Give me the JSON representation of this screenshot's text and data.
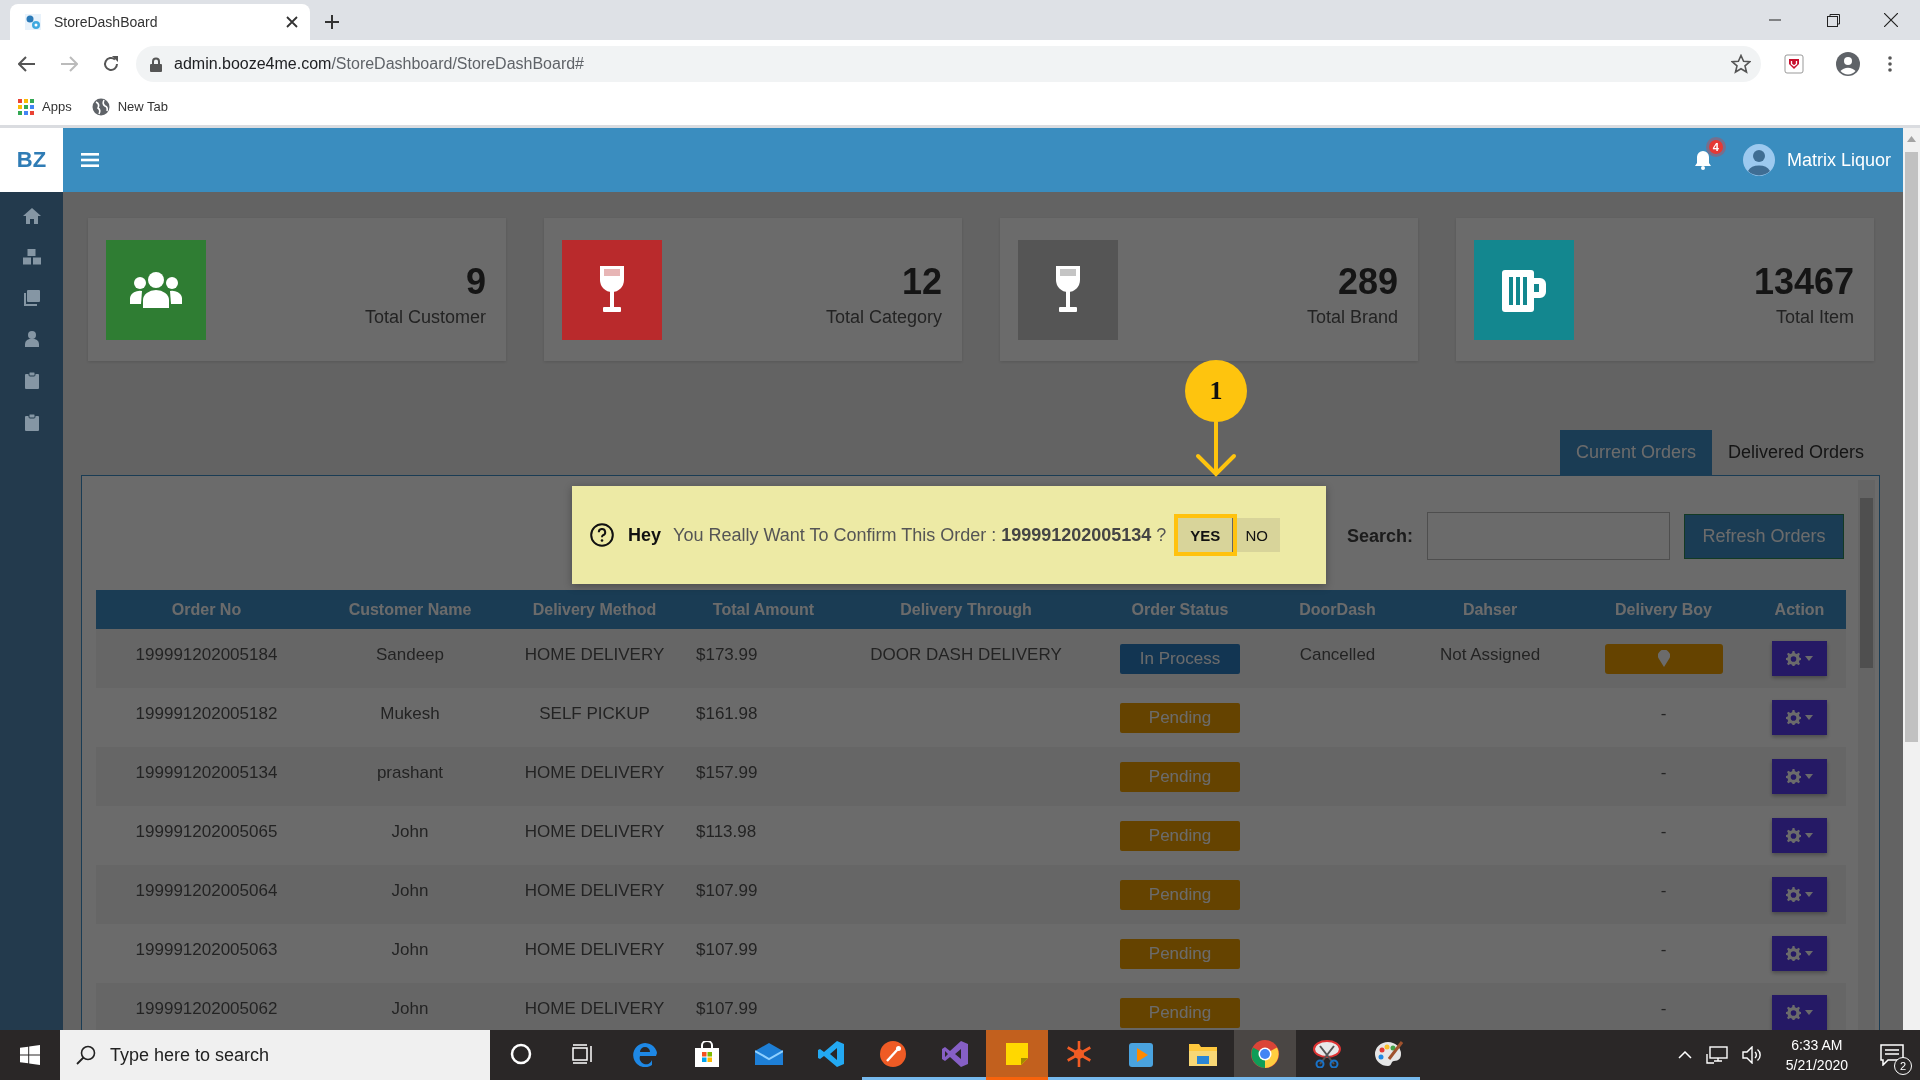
{
  "browser": {
    "tab_title": "StoreDashBoard",
    "url_host": "admin.booze4me.com",
    "url_path": "/StoreDashboard/StoreDashBoard#",
    "forward_disabled": true,
    "bookmarks": [
      {
        "kind": "apps",
        "label": "Apps"
      },
      {
        "kind": "globe",
        "label": "New Tab"
      }
    ]
  },
  "header": {
    "logo": "BZ",
    "notification_count": "4",
    "user_name": "Matrix Liquor"
  },
  "stats": [
    {
      "kind": "customers",
      "value": "9",
      "label": "Total Customer",
      "color": "#2f7d33"
    },
    {
      "kind": "glass",
      "value": "12",
      "label": "Total Category",
      "color": "#b92a2c"
    },
    {
      "kind": "glass",
      "value": "289",
      "label": "Total Brand",
      "color": "#555555"
    },
    {
      "kind": "mug",
      "value": "13467",
      "label": "Total Item",
      "color": "#13878f"
    }
  ],
  "order_tabs": [
    {
      "label": "Current Orders",
      "selected": true
    },
    {
      "label": "Delivered Orders",
      "selected": false
    }
  ],
  "search": {
    "label": "Search:"
  },
  "refresh_button": "Refresh Orders",
  "table": {
    "columns": [
      "Order No",
      "Customer Name",
      "Delivery Method",
      "Total Amount",
      "Delivery Through",
      "Order Status",
      "DoorDash",
      "Dahser",
      "Delivery Boy",
      "Action"
    ],
    "rows": [
      {
        "order_no": "199991202005184",
        "customer": "Sandeep",
        "method": "HOME DELIVERY",
        "amount": "$173.99",
        "through": "DOOR DASH DELIVERY",
        "status": {
          "kind": "in-process",
          "text": "In Process"
        },
        "doordash": "Cancelled",
        "dasher": "Not Assigned",
        "delivery_boy": {
          "kind": "locate"
        }
      },
      {
        "order_no": "199991202005182",
        "customer": "Mukesh",
        "method": "SELF PICKUP",
        "amount": "$161.98",
        "status": {
          "kind": "pending",
          "text": "Pending"
        },
        "delivery_boy": {
          "kind": "text",
          "text": "-"
        }
      },
      {
        "order_no": "199991202005134",
        "customer": "prashant",
        "method": "HOME DELIVERY",
        "amount": "$157.99",
        "status": {
          "kind": "pending",
          "text": "Pending"
        },
        "delivery_boy": {
          "kind": "text",
          "text": "-"
        }
      },
      {
        "order_no": "199991202005065",
        "customer": "John",
        "method": "HOME DELIVERY",
        "amount": "$113.98",
        "status": {
          "kind": "pending",
          "text": "Pending"
        },
        "delivery_boy": {
          "kind": "text",
          "text": "-"
        }
      },
      {
        "order_no": "199991202005064",
        "customer": "John",
        "method": "HOME DELIVERY",
        "amount": "$107.99",
        "status": {
          "kind": "pending",
          "text": "Pending"
        },
        "delivery_boy": {
          "kind": "text",
          "text": "-"
        }
      },
      {
        "order_no": "199991202005063",
        "customer": "John",
        "method": "HOME DELIVERY",
        "amount": "$107.99",
        "status": {
          "kind": "pending",
          "text": "Pending"
        },
        "delivery_boy": {
          "kind": "text",
          "text": "-"
        }
      },
      {
        "order_no": "199991202005062",
        "customer": "John",
        "method": "HOME DELIVERY",
        "amount": "$107.99",
        "status": {
          "kind": "pending",
          "text": "Pending"
        },
        "delivery_boy": {
          "kind": "text",
          "text": "-"
        }
      }
    ]
  },
  "dialog": {
    "title": "Hey",
    "message": "You Really Want To Confirm This Order : **199991202005134** ?",
    "buttons": [
      {
        "label": "YES",
        "selected": true
      },
      {
        "label": "NO",
        "selected": false
      }
    ]
  },
  "annotation": {
    "number": "1"
  },
  "taskbar": {
    "search_placeholder": "Type here to search",
    "time": "6:33 AM",
    "date": "5/21/2020",
    "notification_count": "2",
    "apps": [
      {
        "kind": "circle",
        "running": false,
        "active": false
      },
      {
        "kind": "taskview",
        "running": false,
        "active": false
      },
      {
        "kind": "edge",
        "running": false,
        "active": false
      },
      {
        "kind": "store",
        "running": false,
        "active": false
      },
      {
        "kind": "mail",
        "running": false,
        "active": false
      },
      {
        "kind": "code",
        "running": false,
        "active": false
      },
      {
        "kind": "rocket",
        "running": true,
        "active": false
      },
      {
        "kind": "vs",
        "running": true,
        "active": false
      },
      {
        "kind": "sticky",
        "running": true,
        "active": true
      },
      {
        "kind": "asterisk",
        "running": true,
        "active": false
      },
      {
        "kind": "media",
        "running": true,
        "active": false
      },
      {
        "kind": "folder",
        "running": true,
        "active": false
      },
      {
        "kind": "chrome",
        "running": true,
        "active": true
      },
      {
        "kind": "scissors",
        "running": true,
        "active": false
      },
      {
        "kind": "palette",
        "running": true,
        "active": false
      }
    ]
  }
}
